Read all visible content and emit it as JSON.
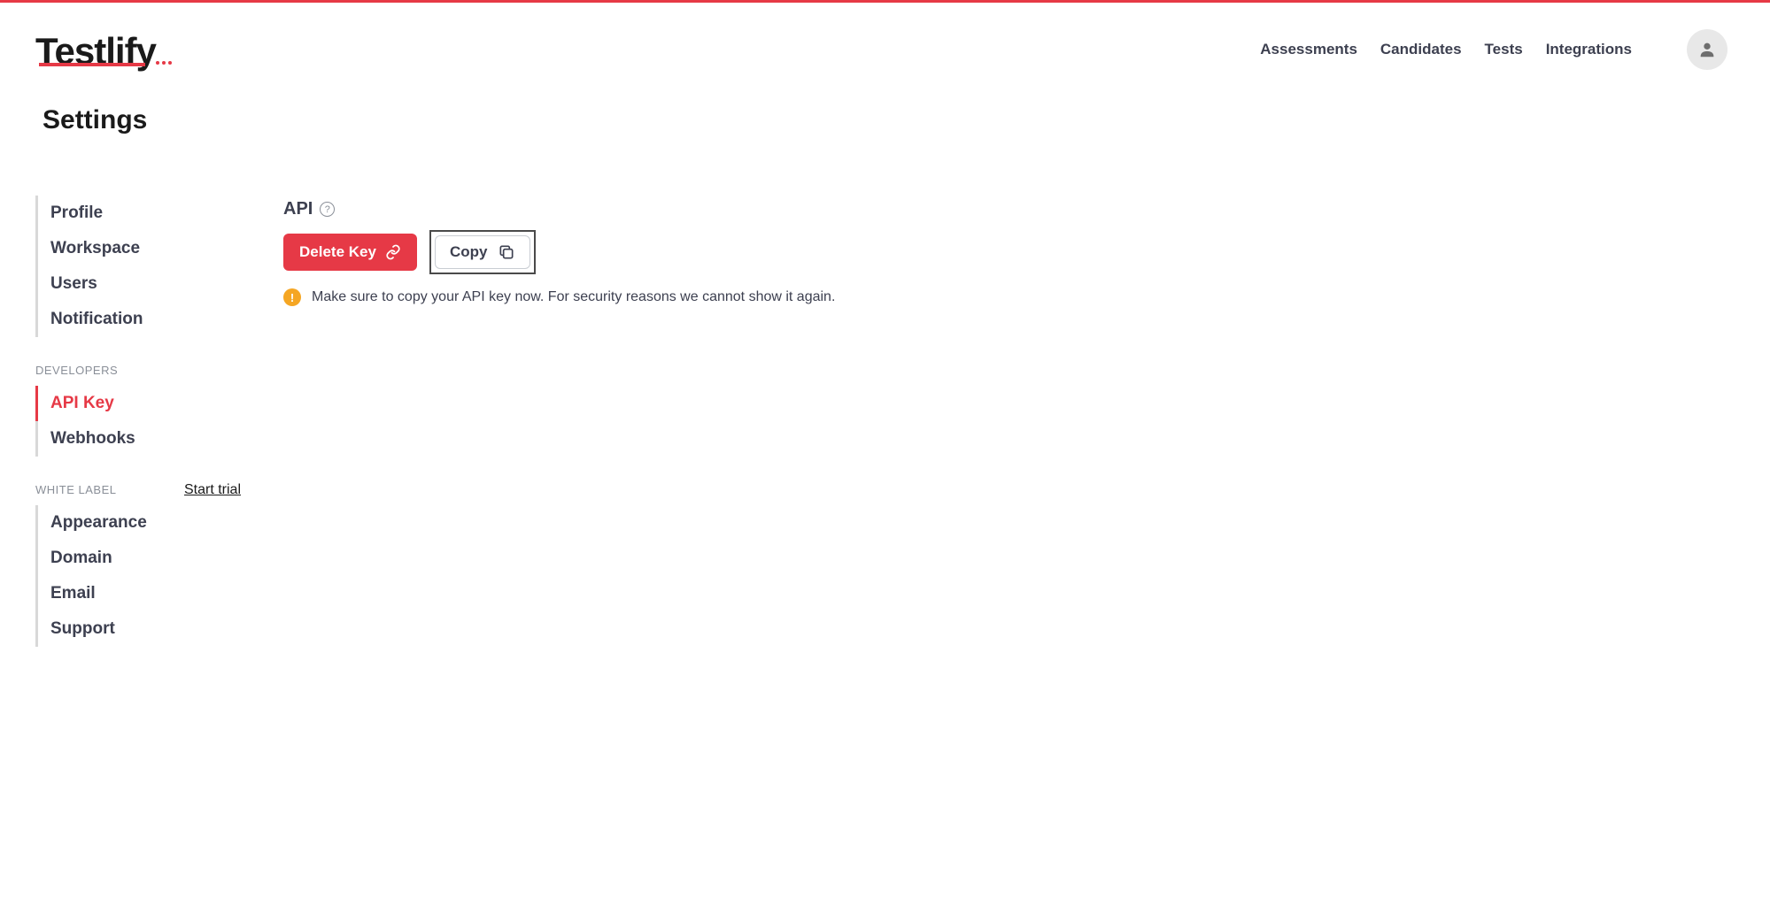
{
  "brand": {
    "name": "Testlify"
  },
  "nav": {
    "assessments": "Assessments",
    "candidates": "Candidates",
    "tests": "Tests",
    "integrations": "Integrations"
  },
  "page": {
    "title": "Settings"
  },
  "sidebar": {
    "profile": "Profile",
    "workspace": "Workspace",
    "users": "Users",
    "notification": "Notification",
    "developers_label": "DEVELOPERS",
    "api_key": "API Key",
    "webhooks": "Webhooks",
    "white_label_label": "WHITE LABEL",
    "start_trial": "Start trial",
    "appearance": "Appearance",
    "domain": "Domain",
    "email": "Email",
    "support": "Support"
  },
  "content": {
    "api_label": "API",
    "help_symbol": "?",
    "delete_key": "Delete Key",
    "copy": "Copy",
    "warn_symbol": "!",
    "warn_text": "Make sure to copy your API key now. For security reasons we cannot show it again."
  }
}
